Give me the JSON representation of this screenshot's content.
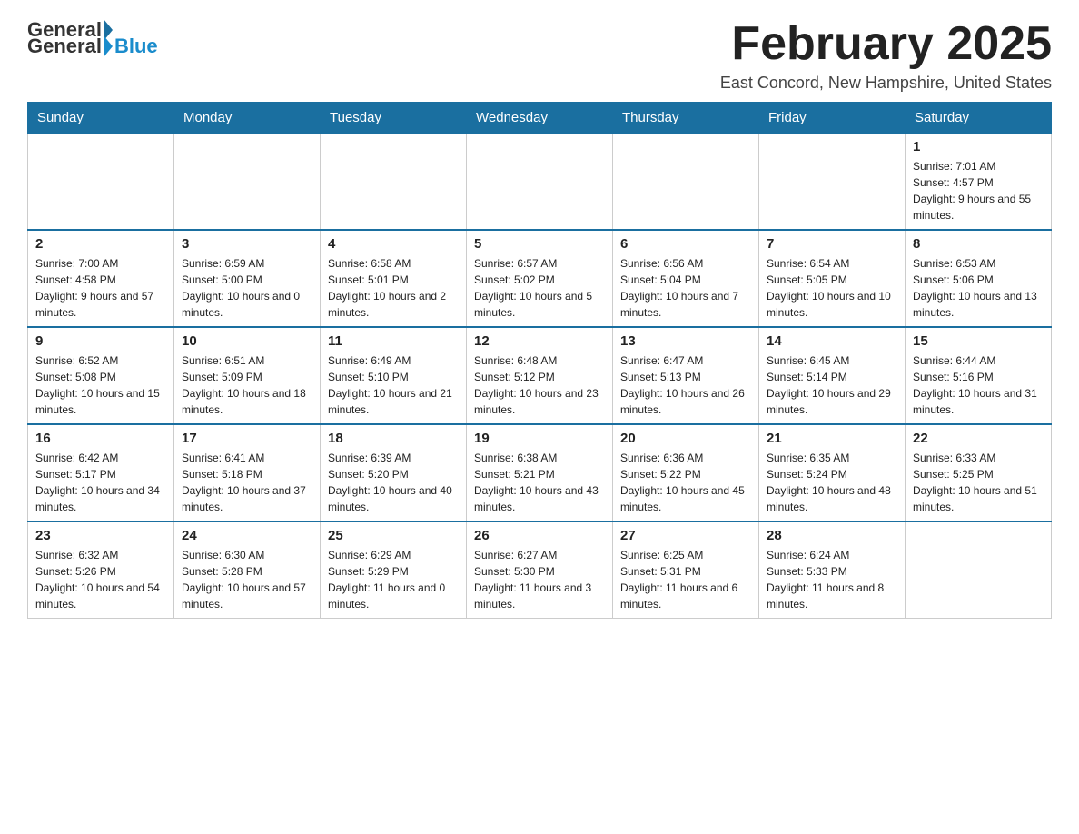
{
  "header": {
    "logo_general": "General",
    "logo_blue": "Blue",
    "title": "February 2025",
    "subtitle": "East Concord, New Hampshire, United States"
  },
  "days_of_week": [
    "Sunday",
    "Monday",
    "Tuesday",
    "Wednesday",
    "Thursday",
    "Friday",
    "Saturday"
  ],
  "weeks": [
    [
      {
        "day": "",
        "info": ""
      },
      {
        "day": "",
        "info": ""
      },
      {
        "day": "",
        "info": ""
      },
      {
        "day": "",
        "info": ""
      },
      {
        "day": "",
        "info": ""
      },
      {
        "day": "",
        "info": ""
      },
      {
        "day": "1",
        "info": "Sunrise: 7:01 AM\nSunset: 4:57 PM\nDaylight: 9 hours and 55 minutes."
      }
    ],
    [
      {
        "day": "2",
        "info": "Sunrise: 7:00 AM\nSunset: 4:58 PM\nDaylight: 9 hours and 57 minutes."
      },
      {
        "day": "3",
        "info": "Sunrise: 6:59 AM\nSunset: 5:00 PM\nDaylight: 10 hours and 0 minutes."
      },
      {
        "day": "4",
        "info": "Sunrise: 6:58 AM\nSunset: 5:01 PM\nDaylight: 10 hours and 2 minutes."
      },
      {
        "day": "5",
        "info": "Sunrise: 6:57 AM\nSunset: 5:02 PM\nDaylight: 10 hours and 5 minutes."
      },
      {
        "day": "6",
        "info": "Sunrise: 6:56 AM\nSunset: 5:04 PM\nDaylight: 10 hours and 7 minutes."
      },
      {
        "day": "7",
        "info": "Sunrise: 6:54 AM\nSunset: 5:05 PM\nDaylight: 10 hours and 10 minutes."
      },
      {
        "day": "8",
        "info": "Sunrise: 6:53 AM\nSunset: 5:06 PM\nDaylight: 10 hours and 13 minutes."
      }
    ],
    [
      {
        "day": "9",
        "info": "Sunrise: 6:52 AM\nSunset: 5:08 PM\nDaylight: 10 hours and 15 minutes."
      },
      {
        "day": "10",
        "info": "Sunrise: 6:51 AM\nSunset: 5:09 PM\nDaylight: 10 hours and 18 minutes."
      },
      {
        "day": "11",
        "info": "Sunrise: 6:49 AM\nSunset: 5:10 PM\nDaylight: 10 hours and 21 minutes."
      },
      {
        "day": "12",
        "info": "Sunrise: 6:48 AM\nSunset: 5:12 PM\nDaylight: 10 hours and 23 minutes."
      },
      {
        "day": "13",
        "info": "Sunrise: 6:47 AM\nSunset: 5:13 PM\nDaylight: 10 hours and 26 minutes."
      },
      {
        "day": "14",
        "info": "Sunrise: 6:45 AM\nSunset: 5:14 PM\nDaylight: 10 hours and 29 minutes."
      },
      {
        "day": "15",
        "info": "Sunrise: 6:44 AM\nSunset: 5:16 PM\nDaylight: 10 hours and 31 minutes."
      }
    ],
    [
      {
        "day": "16",
        "info": "Sunrise: 6:42 AM\nSunset: 5:17 PM\nDaylight: 10 hours and 34 minutes."
      },
      {
        "day": "17",
        "info": "Sunrise: 6:41 AM\nSunset: 5:18 PM\nDaylight: 10 hours and 37 minutes."
      },
      {
        "day": "18",
        "info": "Sunrise: 6:39 AM\nSunset: 5:20 PM\nDaylight: 10 hours and 40 minutes."
      },
      {
        "day": "19",
        "info": "Sunrise: 6:38 AM\nSunset: 5:21 PM\nDaylight: 10 hours and 43 minutes."
      },
      {
        "day": "20",
        "info": "Sunrise: 6:36 AM\nSunset: 5:22 PM\nDaylight: 10 hours and 45 minutes."
      },
      {
        "day": "21",
        "info": "Sunrise: 6:35 AM\nSunset: 5:24 PM\nDaylight: 10 hours and 48 minutes."
      },
      {
        "day": "22",
        "info": "Sunrise: 6:33 AM\nSunset: 5:25 PM\nDaylight: 10 hours and 51 minutes."
      }
    ],
    [
      {
        "day": "23",
        "info": "Sunrise: 6:32 AM\nSunset: 5:26 PM\nDaylight: 10 hours and 54 minutes."
      },
      {
        "day": "24",
        "info": "Sunrise: 6:30 AM\nSunset: 5:28 PM\nDaylight: 10 hours and 57 minutes."
      },
      {
        "day": "25",
        "info": "Sunrise: 6:29 AM\nSunset: 5:29 PM\nDaylight: 11 hours and 0 minutes."
      },
      {
        "day": "26",
        "info": "Sunrise: 6:27 AM\nSunset: 5:30 PM\nDaylight: 11 hours and 3 minutes."
      },
      {
        "day": "27",
        "info": "Sunrise: 6:25 AM\nSunset: 5:31 PM\nDaylight: 11 hours and 6 minutes."
      },
      {
        "day": "28",
        "info": "Sunrise: 6:24 AM\nSunset: 5:33 PM\nDaylight: 11 hours and 8 minutes."
      },
      {
        "day": "",
        "info": ""
      }
    ]
  ]
}
